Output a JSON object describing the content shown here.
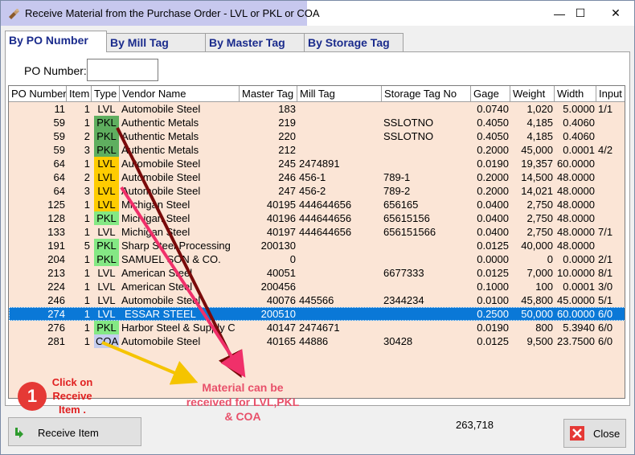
{
  "window": {
    "title": "Receive Material from the Purchase Order - LVL or PKL or COA",
    "minimize": "—",
    "maximize": "☐",
    "close": "✕"
  },
  "tabs": [
    {
      "label": "By PO Number",
      "active": true
    },
    {
      "label": "By Mill Tag",
      "active": false
    },
    {
      "label": "By Master Tag",
      "active": false
    },
    {
      "label": "By Storage Tag",
      "active": false
    }
  ],
  "search": {
    "label": "PO Number:",
    "value": ""
  },
  "grid": {
    "columns": [
      "PO Number",
      "Item",
      "Type",
      "Vendor Name",
      "Master Tag",
      "Mill Tag",
      "Storage Tag No",
      "Gage",
      "Weight",
      "Width",
      "Input"
    ],
    "type_colors": {
      "LVL": "#ffcc00",
      "PKL_dark": "#5fae5f",
      "PKL": "#84e884",
      "COA": "#c4ccee",
      "none": "transparent"
    },
    "rows": [
      {
        "po": "11",
        "item": "1",
        "type": "LVL",
        "vendor": "Automobile Steel",
        "master": "183",
        "mill": "",
        "storage": "",
        "gage": "0.0740",
        "weight": "1,020",
        "width": "5.0000",
        "input": "1/1",
        "color": "none"
      },
      {
        "po": "59",
        "item": "1",
        "type": "PKL",
        "vendor": "Authentic Metals",
        "master": "219",
        "mill": "",
        "storage": "SSLOTNO",
        "gage": "0.4050",
        "weight": "4,185",
        "width": "0.4060",
        "input": "",
        "color": "PKL_dark"
      },
      {
        "po": "59",
        "item": "2",
        "type": "PKL",
        "vendor": "Authentic Metals",
        "master": "220",
        "mill": "",
        "storage": "SSLOTNO",
        "gage": "0.4050",
        "weight": "4,185",
        "width": "0.4060",
        "input": "",
        "color": "PKL_dark"
      },
      {
        "po": "59",
        "item": "3",
        "type": "PKL",
        "vendor": "Authentic Metals",
        "master": "212",
        "mill": "",
        "storage": "",
        "gage": "0.2000",
        "weight": "45,000",
        "width": "0.0001",
        "input": "4/2",
        "color": "PKL_dark"
      },
      {
        "po": "64",
        "item": "1",
        "type": "LVL",
        "vendor": "Automobile Steel",
        "master": "245",
        "mill": "2474891",
        "storage": "",
        "gage": "0.0190",
        "weight": "19,357",
        "width": "60.0000",
        "input": "",
        "color": "LVL"
      },
      {
        "po": "64",
        "item": "2",
        "type": "LVL",
        "vendor": "Automobile Steel",
        "master": "246",
        "mill": "456-1",
        "storage": "789-1",
        "gage": "0.2000",
        "weight": "14,500",
        "width": "48.0000",
        "input": "",
        "color": "LVL"
      },
      {
        "po": "64",
        "item": "3",
        "type": "LVL",
        "vendor": "Automobile Steel",
        "master": "247",
        "mill": "456-2",
        "storage": "789-2",
        "gage": "0.2000",
        "weight": "14,021",
        "width": "48.0000",
        "input": "",
        "color": "LVL"
      },
      {
        "po": "125",
        "item": "1",
        "type": "LVL",
        "vendor": "Michigan Steel",
        "master": "40195",
        "mill": "444644656",
        "storage": "656165",
        "gage": "0.0400",
        "weight": "2,750",
        "width": "48.0000",
        "input": "",
        "color": "LVL"
      },
      {
        "po": "128",
        "item": "1",
        "type": "PKL",
        "vendor": "Michigan Steel",
        "master": "40196",
        "mill": "444644656",
        "storage": "65615156",
        "gage": "0.0400",
        "weight": "2,750",
        "width": "48.0000",
        "input": "",
        "color": "PKL"
      },
      {
        "po": "133",
        "item": "1",
        "type": "LVL",
        "vendor": "Michigan Steel",
        "master": "40197",
        "mill": "444644656",
        "storage": "656151566",
        "gage": "0.0400",
        "weight": "2,750",
        "width": "48.0000",
        "input": "7/1",
        "color": "none"
      },
      {
        "po": "191",
        "item": "5",
        "type": "PKL",
        "vendor": "Sharp Steel Processing",
        "master": "200130",
        "mill": "",
        "storage": "",
        "gage": "0.0125",
        "weight": "40,000",
        "width": "48.0000",
        "input": "",
        "color": "PKL"
      },
      {
        "po": "204",
        "item": "1",
        "type": "PKL",
        "vendor": "SAMUEL SON & CO.",
        "master": "0",
        "mill": "",
        "storage": "",
        "gage": "0.0000",
        "weight": "0",
        "width": "0.0000",
        "input": "2/1",
        "color": "PKL"
      },
      {
        "po": "213",
        "item": "1",
        "type": "LVL",
        "vendor": "American Steel",
        "master": "40051",
        "mill": "",
        "storage": "6677333",
        "gage": "0.0125",
        "weight": "7,000",
        "width": "10.0000",
        "input": "8/1",
        "color": "none"
      },
      {
        "po": "224",
        "item": "1",
        "type": "LVL",
        "vendor": "American Steel",
        "master": "200456",
        "mill": "",
        "storage": "",
        "gage": "0.1000",
        "weight": "100",
        "width": "0.0001",
        "input": "3/0",
        "color": "none"
      },
      {
        "po": "246",
        "item": "1",
        "type": "LVL",
        "vendor": "Automobile Steel",
        "master": "40076",
        "mill": "445566",
        "storage": "2344234",
        "gage": "0.0100",
        "weight": "45,800",
        "width": "45.0000",
        "input": "5/1",
        "color": "none"
      },
      {
        "po": "274",
        "item": "1",
        "type": "LVL",
        "vendor": "ESSAR STEEL",
        "master": "200510",
        "mill": "",
        "storage": "",
        "gage": "0.2500",
        "weight": "50,000",
        "width": "60.0000",
        "input": "6/0",
        "color": "none",
        "selected": true
      },
      {
        "po": "276",
        "item": "1",
        "type": "PKL",
        "vendor": "Harbor Steel & Supply C",
        "master": "40147",
        "mill": "2474671",
        "storage": "",
        "gage": "0.0190",
        "weight": "800",
        "width": "5.3940",
        "input": "6/0",
        "color": "PKL"
      },
      {
        "po": "281",
        "item": "1",
        "type": "COA",
        "vendor": "Automobile Steel",
        "master": "40165",
        "mill": "44886",
        "storage": "30428",
        "gage": "0.0125",
        "weight": "9,500",
        "width": "23.7500",
        "input": "6/0",
        "color": "COA"
      }
    ]
  },
  "annotations": {
    "step_number": "1",
    "step_text": "Click on Receive Item .",
    "note": "Material can be received for LVL,PKL & COA",
    "arrow_colors": {
      "dark": "#7a0a0a",
      "pink": "#f0306a",
      "yellow": "#f5c400"
    }
  },
  "footer": {
    "receive_label": "Receive Item",
    "total": "263,718",
    "close_label": "Close"
  }
}
